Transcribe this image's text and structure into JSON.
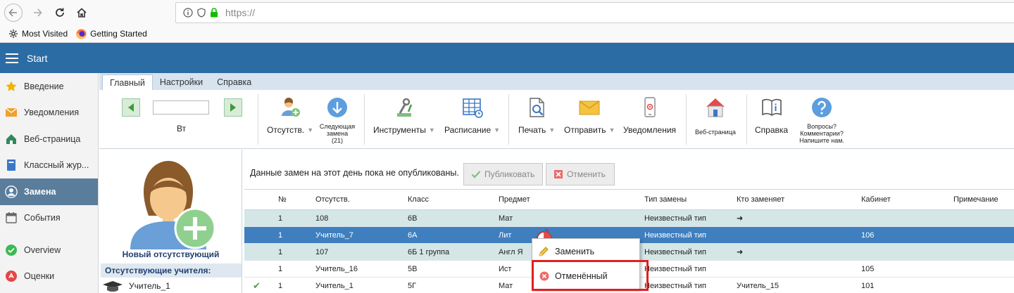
{
  "browser": {
    "url": "https://",
    "bookmarks": [
      {
        "label": "Most Visited"
      },
      {
        "label": "Getting Started"
      }
    ]
  },
  "app": {
    "title": "Start"
  },
  "sidebar": {
    "items": [
      {
        "label": "Введение",
        "icon": "star-icon",
        "color": "#f0b400"
      },
      {
        "label": "Уведомления",
        "icon": "envelope-icon",
        "color": "#f0a030"
      },
      {
        "label": "Веб-страница",
        "icon": "home-icon",
        "color": "#2e8a5e"
      },
      {
        "label": "Классный жур...",
        "icon": "notebook-icon",
        "color": "#3b77c6"
      },
      {
        "label": "Замена",
        "icon": "user-icon",
        "color": "#ffffff"
      },
      {
        "label": "События",
        "icon": "calendar-icon",
        "color": "#666666"
      },
      {
        "label": "Overview",
        "icon": "check-circle-icon",
        "color": "#3cba54"
      },
      {
        "label": "Оценки",
        "icon": "grade-icon",
        "color": "#e64545"
      }
    ]
  },
  "tabs": [
    {
      "label": "Главный"
    },
    {
      "label": "Настройки"
    },
    {
      "label": "Справка"
    }
  ],
  "ribbon": {
    "day": "Вт",
    "date_value": "",
    "absent_label": "Отсутств.",
    "next_sub_label_1": "Следующая",
    "next_sub_label_2": "замена",
    "next_sub_count": "(21)",
    "tools_label": "Инструменты",
    "schedule_label": "Расписание",
    "print_label": "Печать",
    "send_label": "Отправить",
    "notify_label": "Уведомления",
    "web_label": "Веб-страница",
    "help_label": "Справка",
    "questions_1": "Вопросы?",
    "questions_2": "Комментарии?",
    "questions_3": "Напишите нам."
  },
  "left_panel": {
    "new_absent": "Новый отсутствующий",
    "absent_title": "Отсутствующие учителя:",
    "absent_teachers": [
      {
        "name": "Учитель_1"
      }
    ]
  },
  "main": {
    "notice": "Данные замен на этот день пока не опубликованы.",
    "publish_label": "Публиковать",
    "cancel_label": "Отменить"
  },
  "grid": {
    "headers": {
      "num": "№",
      "absent": "Отсутств.",
      "class": "Класс",
      "subject": "Предмет",
      "type": "Тип замены",
      "who": "Кто заменяет",
      "room": "Кабинет",
      "note": "Примечание"
    },
    "rows": [
      {
        "status": "",
        "num": "1",
        "absent": "108",
        "class": "6В",
        "subject": "Мат",
        "type": "Неизвестный тип",
        "who": "➜",
        "room": "",
        "note": "",
        "style": "green"
      },
      {
        "status": "",
        "num": "1",
        "absent": "Учитель_7",
        "class": "6А",
        "subject": "Лит",
        "type": "Неизвестный тип",
        "who": "",
        "room": "106",
        "note": "",
        "style": "selected"
      },
      {
        "status": "",
        "num": "1",
        "absent": "107",
        "class": "6Б 1 группа",
        "subject": "Англ Я",
        "type": "Неизвестный тип",
        "who": "➜",
        "room": "",
        "note": "",
        "style": "green"
      },
      {
        "status": "",
        "num": "1",
        "absent": "Учитель_16",
        "class": "5В",
        "subject": "Ист",
        "type": "Неизвестный тип",
        "who": "",
        "room": "105",
        "note": "",
        "style": "plain"
      },
      {
        "status": "✔",
        "num": "1",
        "absent": "Учитель_1",
        "class": "5Г",
        "subject": "Мат",
        "type": "Неизвестный тип",
        "who": "Учитель_15",
        "room": "101",
        "note": "",
        "style": "plain"
      }
    ]
  },
  "context_menu": {
    "replace_label": "Заменить",
    "cancelled_label": "Отменённый"
  }
}
